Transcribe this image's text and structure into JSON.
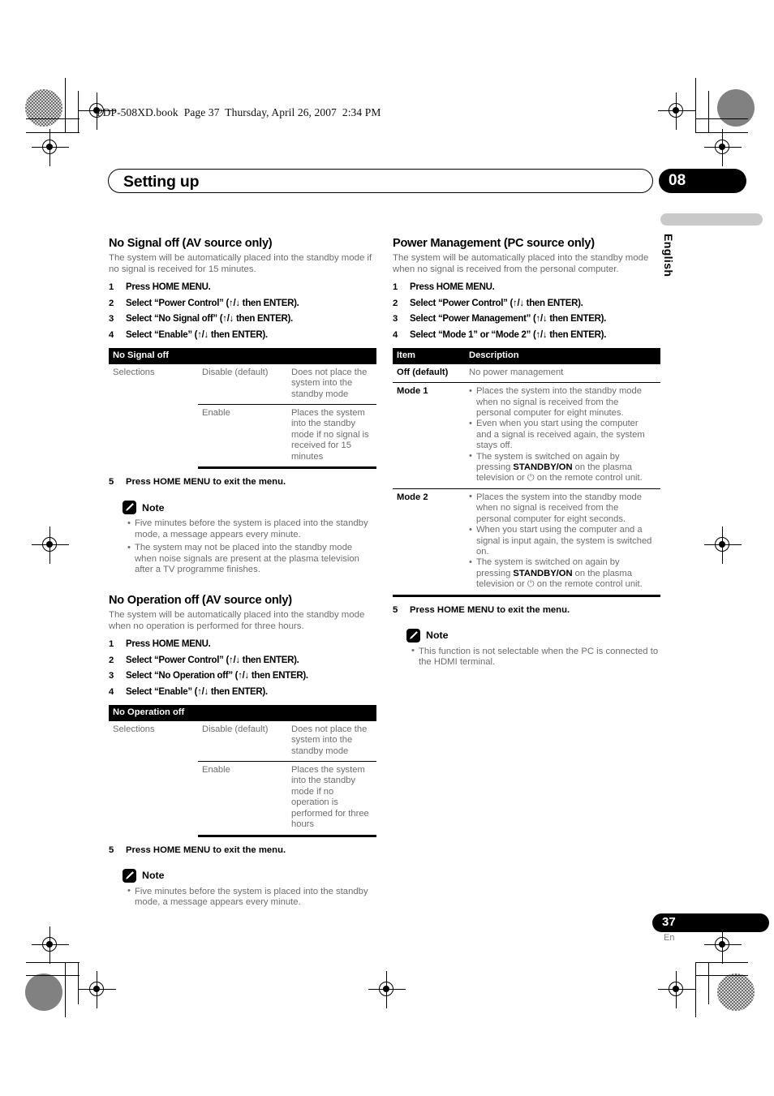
{
  "print_header": "PDP-508XD.book  Page 37  Thursday, April 26, 2007  2:34 PM",
  "chapter": {
    "title": "Setting up",
    "number": "08"
  },
  "language_tab": "English",
  "footer": {
    "page_number": "37",
    "language_code": "En"
  },
  "left_column": {
    "section1": {
      "heading": "No Signal off (AV source only)",
      "intro": "The system will be automatically placed into the standby mode if no signal is received for 15 minutes.",
      "steps": [
        {
          "num": "1",
          "text": "Press HOME MENU."
        },
        {
          "num": "2",
          "text": "Select “Power Control” (↑/↓ then ENTER)."
        },
        {
          "num": "3",
          "text": "Select “No Signal off” (↑/↓ then ENTER)."
        },
        {
          "num": "4",
          "text": "Select “Enable” (↑/↓ then ENTER)."
        }
      ],
      "table": {
        "header": "No Signal off",
        "row_label": "Selections",
        "rows": [
          {
            "option": "Disable (default)",
            "description": "Does not place the system into the standby mode"
          },
          {
            "option": "Enable",
            "description": "Places the system into the standby mode if no signal is received for 15 minutes"
          }
        ]
      },
      "step5": {
        "num": "5",
        "text": "Press HOME MENU to exit the menu."
      },
      "note": {
        "title": "Note",
        "items": [
          "Five minutes before the system is placed into the standby mode, a message appears every minute.",
          "The system may not be placed into the standby mode when noise signals are present at the plasma television after a TV programme finishes."
        ]
      }
    },
    "section2": {
      "heading": "No Operation off (AV source only)",
      "intro": "The system will be automatically placed into the standby mode when no operation is performed for three hours.",
      "steps": [
        {
          "num": "1",
          "text": "Press HOME MENU."
        },
        {
          "num": "2",
          "text": "Select “Power Control” (↑/↓ then ENTER)."
        },
        {
          "num": "3",
          "text": "Select “No Operation off” (↑/↓ then ENTER)."
        },
        {
          "num": "4",
          "text": "Select “Enable” (↑/↓ then ENTER)."
        }
      ],
      "table": {
        "header": "No Operation off",
        "row_label": "Selections",
        "rows": [
          {
            "option": "Disable (default)",
            "description": "Does not place the system into the standby mode"
          },
          {
            "option": "Enable",
            "description": "Places the system into the standby mode if no operation is performed for three hours"
          }
        ]
      },
      "step5": {
        "num": "5",
        "text": "Press HOME MENU to exit the menu."
      },
      "note": {
        "title": "Note",
        "items": [
          "Five minutes before the system is placed into the standby mode, a message appears every minute."
        ]
      }
    }
  },
  "right_column": {
    "section1": {
      "heading": "Power Management (PC source only)",
      "intro": "The system will be automatically placed into the standby mode when no signal is received from the personal computer.",
      "steps": [
        {
          "num": "1",
          "text": "Press HOME MENU."
        },
        {
          "num": "2",
          "text": "Select “Power Control” (↑/↓ then ENTER)."
        },
        {
          "num": "3",
          "text": "Select “Power Management” (↑/↓ then ENTER)."
        },
        {
          "num": "4",
          "text": "Select “Mode 1” or “Mode 2” (↑/↓ then ENTER)."
        }
      ],
      "table": {
        "col_item": "Item",
        "col_description": "Description",
        "rows": [
          {
            "item": "Off (default)",
            "bullets": [
              "No power management"
            ]
          },
          {
            "item": "Mode 1",
            "bullets": [
              "Places the system into the standby mode when no signal is received from the personal computer for eight minutes.",
              "Even when you start using the computer and a signal is received again, the system stays off.",
              "The system is switched on again by pressing STANDBY/ON on the plasma television or ⏻ on the remote control unit."
            ]
          },
          {
            "item": "Mode 2",
            "bullets": [
              "Places the system into the standby mode when no signal is received from the personal computer for eight seconds.",
              "When you start using the computer and a signal is input again, the system is switched on.",
              "The system is switched on again by pressing STANDBY/ON on the plasma television or ⏻ on the remote control unit."
            ]
          }
        ]
      },
      "step5": {
        "num": "5",
        "text": "Press HOME MENU to exit the menu."
      },
      "note": {
        "title": "Note",
        "items": [
          "This function is not selectable when the PC is connected to the HDMI terminal."
        ]
      }
    }
  }
}
